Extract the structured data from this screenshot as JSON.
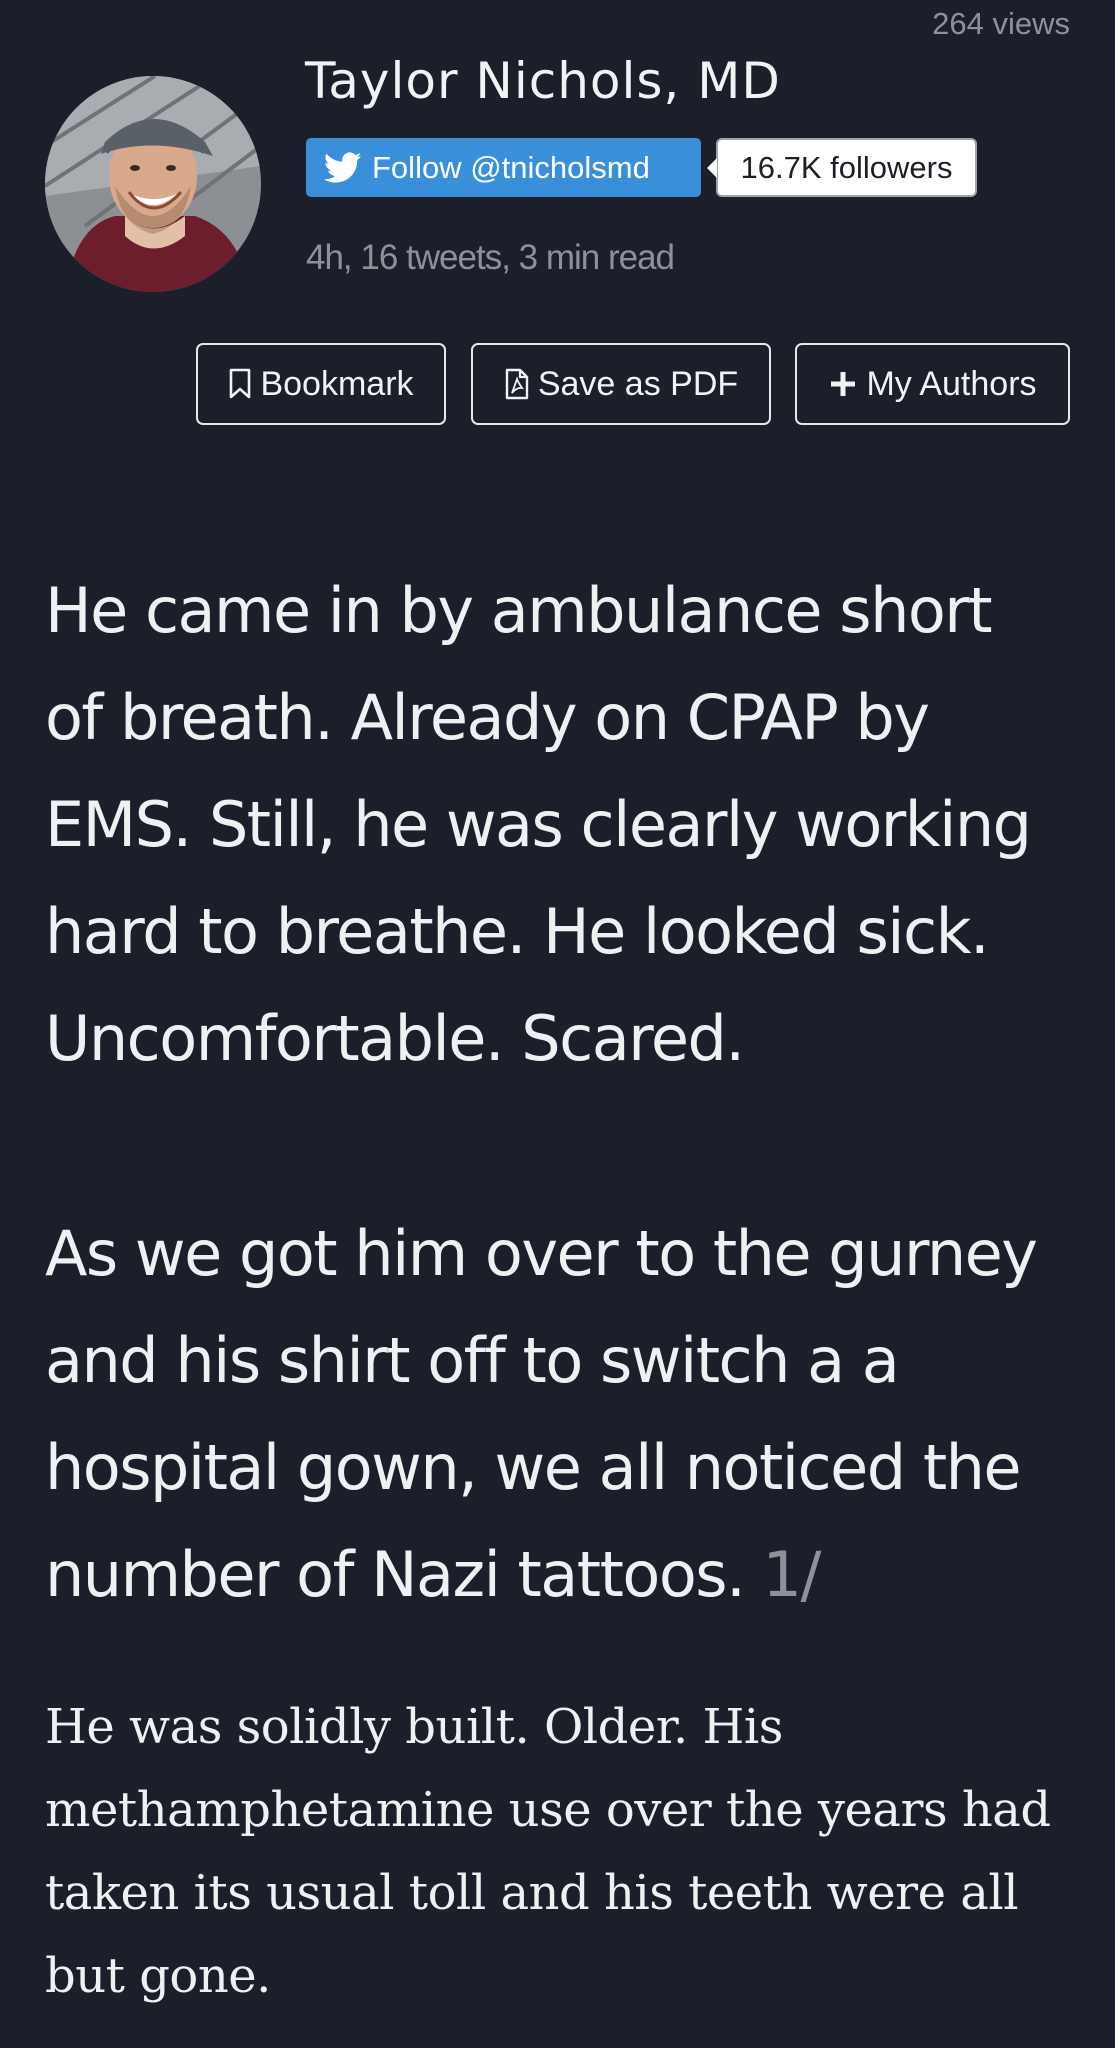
{
  "header": {
    "views": "264 views",
    "author_name": "Taylor Nichols, MD",
    "follow_label": "Follow @tnicholsmd",
    "followers": "16.7K followers",
    "meta": "4h, 16 tweets, 3 min read"
  },
  "actions": {
    "bookmark": "Bookmark",
    "save_pdf": "Save as PDF",
    "my_authors": "My Authors"
  },
  "tweets": {
    "first_para_lines": [
      "He came in by ambulance short",
      "of breath. Already on CPAP by",
      "EMS. Still, he was clearly working",
      "hard to breathe. He looked sick.",
      "Uncomfortable. Scared."
    ],
    "second_para_lines": [
      "As we got him over to the gurney",
      "and his shirt off to switch a a",
      "hospital gown, we all noticed the",
      "number of Nazi tattoos."
    ],
    "tweet_number": "1/",
    "second_tweet_lines": [
      "He was solidly built. Older. His",
      "methamphetamine use over the years had",
      "taken its usual toll and his teeth were all",
      "but gone."
    ]
  },
  "icons": {
    "twitter": "twitter-bird-icon",
    "bookmark": "bookmark-icon",
    "pdf": "pdf-file-icon",
    "plus": "plus-icon"
  },
  "colors": {
    "background": "#1b1f2a",
    "follow_button": "#3a8fdb",
    "muted_text": "#8d919a",
    "primary_text": "#eef0f2"
  }
}
